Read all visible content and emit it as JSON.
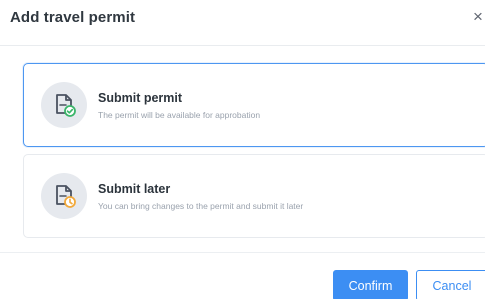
{
  "dialog": {
    "title": "Add travel permit",
    "close_glyph": "×"
  },
  "options": [
    {
      "title": "Submit permit",
      "description": "The permit will be available for approbation",
      "icon": "document-check-icon",
      "badge_color": "#3bb56a",
      "selected": true
    },
    {
      "title": "Submit later",
      "description": "You can bring changes to the permit and submit it later",
      "icon": "document-clock-icon",
      "badge_color": "#f2a93b",
      "selected": false
    }
  ],
  "footer": {
    "confirm_label": "Confirm",
    "cancel_label": "Cancel"
  },
  "colors": {
    "accent": "#3c8ef3",
    "selected_border": "#4d97f1"
  }
}
